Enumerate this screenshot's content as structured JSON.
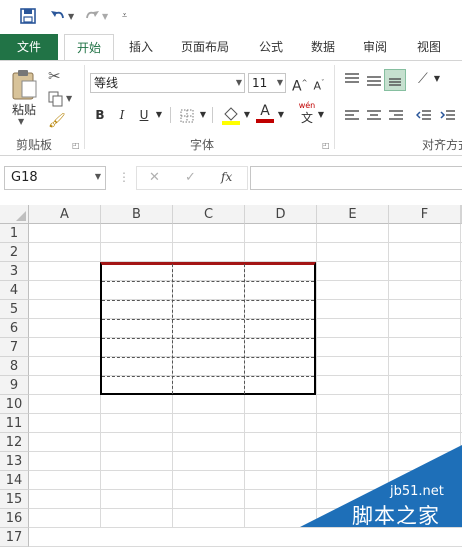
{
  "qat": {
    "save_icon": "save-icon",
    "undo_icon": "undo-icon",
    "redo_icon": "redo-icon",
    "customize_icon": "customize-qat-icon"
  },
  "tabs": [
    {
      "label": "文件",
      "state": "file"
    },
    {
      "label": "开始",
      "state": "active"
    },
    {
      "label": "插入",
      "state": "normal"
    },
    {
      "label": "页面布局",
      "state": "normal"
    },
    {
      "label": "公式",
      "state": "normal"
    },
    {
      "label": "数据",
      "state": "normal"
    },
    {
      "label": "审阅",
      "state": "normal"
    },
    {
      "label": "视图",
      "state": "normal"
    }
  ],
  "ribbon": {
    "clipboard": {
      "paste_label": "粘贴",
      "group_label": "剪贴板"
    },
    "font": {
      "font_name": "等线",
      "font_size": "11",
      "bold": "B",
      "italic": "I",
      "underline": "U",
      "grow": "A",
      "shrink": "A",
      "font_color_letter": "A",
      "phonetic_top": "wén",
      "phonetic_bottom": "文",
      "group_label": "字体",
      "font_color": "#c00000",
      "fill_color": "#ffff00"
    },
    "alignment": {
      "group_label": "对齐方式"
    }
  },
  "formula_bar": {
    "name_box": "G18",
    "cancel": "✕",
    "enter": "✓",
    "fx": "fx",
    "value": ""
  },
  "grid": {
    "columns": [
      "A",
      "B",
      "C",
      "D",
      "E",
      "F"
    ],
    "rows": [
      "1",
      "2",
      "3",
      "4",
      "5",
      "6",
      "7",
      "8",
      "9",
      "10",
      "11",
      "12",
      "13",
      "14",
      "15",
      "16",
      "17"
    ]
  },
  "watermark": {
    "site": "jb51.net",
    "text": "脚本之家"
  },
  "colors": {
    "excel_green": "#217346",
    "header_bg": "#f3f3f3",
    "table_top_border": "#a31515"
  }
}
